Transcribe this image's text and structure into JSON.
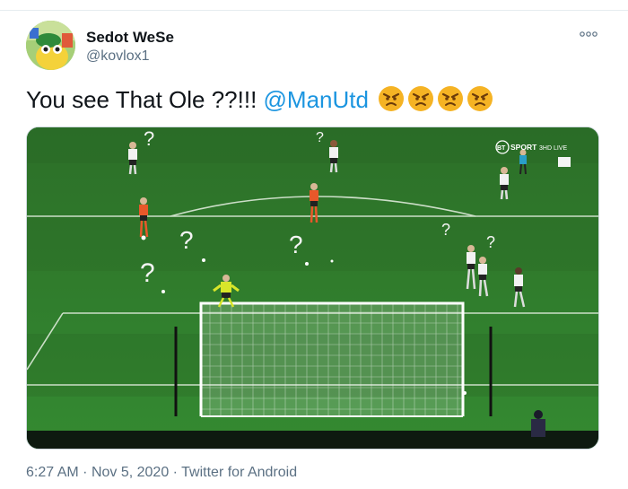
{
  "user": {
    "display_name": "Sedot WeSe",
    "handle": "@kovlox1"
  },
  "more_icon": "more-options-icon",
  "tweet": {
    "text_before": "You see That Ole ??!!! ",
    "mention": "@ManUtd",
    "emojis": [
      "angry-face",
      "angry-face",
      "angry-face",
      "angry-face"
    ]
  },
  "media": {
    "broadcaster_logo": "BT",
    "broadcaster_text": "SPORT",
    "channel": "3HD LIVE",
    "question_marks": [
      "?",
      "?",
      "?",
      "?",
      "?",
      "?",
      "?"
    ]
  },
  "meta": {
    "time": "6:27 AM",
    "separator": "·",
    "date": "Nov 5, 2020",
    "source": "Twitter for Android"
  },
  "colors": {
    "pitch": "#2f7d2c",
    "mention": "#1b95e0",
    "meta": "#5b7083",
    "emoji_face": "#f5b324"
  }
}
